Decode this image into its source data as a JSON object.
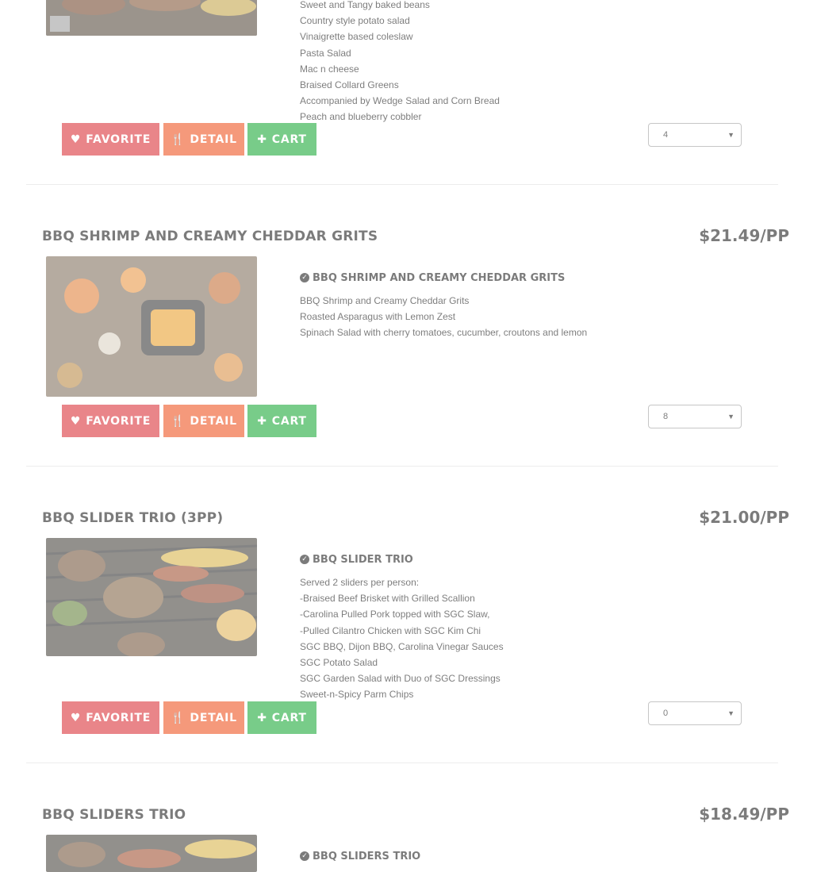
{
  "buttons": {
    "favorite": "FAVORITE",
    "detail": "DETAIL",
    "cart": "CART"
  },
  "colors": {
    "favorite": "#d8222a",
    "detail": "#ee4610",
    "cart": "#0aa32a"
  },
  "items": [
    {
      "lines": [
        "Sweet and Tangy baked beans",
        "Country style potato salad",
        "Vinaigrette based coleslaw",
        "Pasta Salad",
        "Mac n cheese",
        "Braised Collard Greens",
        "Accompanied by Wedge Salad and Corn Bread",
        "Peach and blueberry cobbler"
      ],
      "qty": "4"
    },
    {
      "title": "BBQ SHRIMP AND CREAMY CHEDDAR GRITS",
      "price": "$21.49/PP",
      "desc_title": "BBQ SHRIMP AND CREAMY CHEDDAR GRITS",
      "lines": [
        " BBQ Shrimp and Creamy Cheddar Grits",
        "Roasted Asparagus with Lemon Zest",
        "Spinach Salad with cherry tomatoes, cucumber, croutons and lemon"
      ],
      "qty": "8"
    },
    {
      "title": "BBQ SLIDER TRIO (3PP)",
      "price": "$21.00/PP",
      "desc_title": "BBQ SLIDER TRIO",
      "lines": [
        " Served 2 sliders per person:",
        "-Braised Beef Brisket with Grilled Scallion",
        "-Carolina Pulled Pork topped with SGC Slaw,",
        "-Pulled Cilantro Chicken with SGC Kim Chi",
        "SGC BBQ, Dijon BBQ, Carolina Vinegar Sauces",
        "SGC Potato Salad",
        "SGC Garden Salad with Duo of SGC Dressings",
        "Sweet-n-Spicy Parm Chips"
      ],
      "qty": "0"
    },
    {
      "title": "BBQ SLIDERS TRIO",
      "price": "$18.49/PP",
      "desc_title": "BBQ SLIDERS TRIO"
    }
  ]
}
